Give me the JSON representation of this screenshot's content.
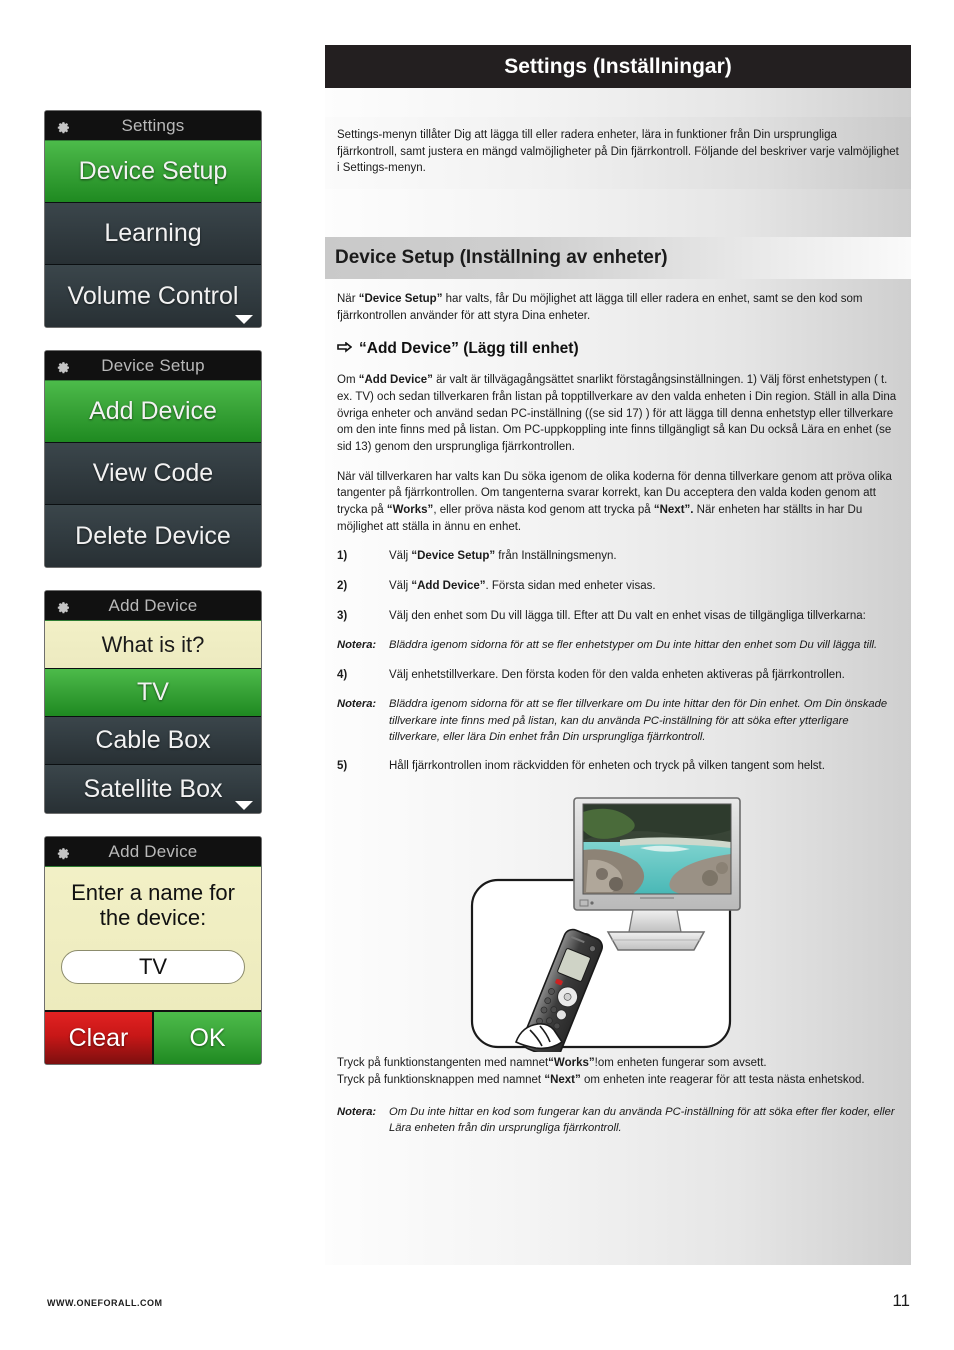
{
  "header": {
    "title": "Settings (Inställningar)"
  },
  "intro": "Settings-menyn tillåter Dig att lägga till eller radera enheter, lära in funktioner från Din ursprungliga fjärrkontroll, samt justera en mängd valmöjligheter på Din fjärrkontroll. Följande del beskriver varje valmöjlighet i Settings-menyn.",
  "section": {
    "title": "Device Setup (Inställning av enheter)"
  },
  "paragraphs": {
    "p1_pre": "När ",
    "p1_b1": "“Device Setup”",
    "p1_post": " har valts, får Du möjlighet att lägga till eller radera en enhet, samt se den kod som fjärrkontrollen använder för att styra Dina enheter.",
    "subheading": "“Add Device” (Lägg till enhet)",
    "p2_pre": "Om ",
    "p2_b1": "“Add Device”",
    "p2_post": " är valt är tillvägagångsättet snarlikt förstagångsinställningen. 1) Välj först enhetstypen ( t. ex. TV) och sedan tillverkaren från listan på topptillverkare av den valda enheten i Din region. Ställ in alla Dina övriga enheter och använd sedan PC-inställning  ((se sid 17) ) för att lägga till denna enhetstyp eller tillverkare om den inte finns med på listan. Om PC-uppkoppling inte finns tillgängligt så kan Du också Lära en enhet (se sid 13) genom den ursprungliga fjärrkontrollen.",
    "p3_pre": "När väl tillverkaren har valts kan Du söka igenom de olika koderna för denna tillverkare genom att pröva olika tangenter på fjärrkontrollen. Om tangenterna svarar korrekt, kan Du acceptera den valda koden genom att trycka på ",
    "p3_b1": "“Works”",
    "p3_mid": ", eller pröva nästa kod genom att trycka på ",
    "p3_b2": "“Next”.",
    "p3_post": " När enheten har ställts in har Du möjlighet att ställa in ännu en enhet."
  },
  "steps": [
    {
      "num": "1)",
      "pre": "Välj ",
      "bold": "“Device Setup”",
      "post": "  från Inställningsmenyn."
    },
    {
      "num": "2)",
      "pre": "Välj ",
      "bold": "“Add Device”",
      "post": ". Första sidan med enheter visas."
    },
    {
      "num": "3)",
      "pre": "Välj den enhet som Du vill lägga till. Efter att Du valt en enhet visas de tillgängliga tillverkarna:",
      "bold": "",
      "post": ""
    },
    {
      "num": "4)",
      "pre": "Välj enhetstillverkare. Den första koden för den valda enheten aktiveras på fjärrkontrollen.",
      "bold": "",
      "post": ""
    },
    {
      "num": "5)",
      "pre": "Håll fjärrkontrollen inom räckvidden för enheten och tryck på vilken tangent som helst.",
      "bold": "",
      "post": ""
    }
  ],
  "notes": {
    "label": "Notera:",
    "note1": "Bläddra igenom sidorna för att se fler enhetstyper om Du inte hittar den enhet som Du vill lägga till.",
    "note2": "Bläddra igenom sidorna för att se fler tillverkare om Du inte hittar den för Din enhet.  Om Din önskade tillverkare inte finns med på listan, kan du använda PC-inställning för att söka efter ytterligare tillverkare, eller lära Din enhet från Din ursprungliga fjärrkontroll.",
    "note3": "Om Du inte hittar en kod som fungerar kan du använda PC-inställning för att söka efter fler koder, eller Lära enheten från din ursprungliga fjärrkontroll."
  },
  "closing": {
    "line1_pre": "Tryck på funktionstangenten med namnet",
    "line1_b": "“Works”",
    "line1_post": "!om enheten fungerar som avsett.",
    "line2_pre": "Tryck på funktionsknappen med namnet ",
    "line2_b": "“Next”",
    "line2_post": " om enheten inte reagerar för att testa nästa enhetskod."
  },
  "screens": [
    {
      "id": "settings",
      "header": "Settings",
      "rows": [
        {
          "label": "Device Setup",
          "state": "green"
        },
        {
          "label": "Learning",
          "state": "dark"
        },
        {
          "label": "Volume Control",
          "state": "dark",
          "caret": true
        }
      ]
    },
    {
      "id": "device-setup",
      "header": "Device Setup",
      "rows": [
        {
          "label": "Add Device",
          "state": "green"
        },
        {
          "label": "View Code",
          "state": "dark"
        },
        {
          "label": "Delete Device",
          "state": "dark"
        }
      ]
    },
    {
      "id": "add-device-list",
      "header": "Add Device",
      "rows": [
        {
          "label": "What is it?",
          "state": "yellow"
        },
        {
          "label": "TV",
          "state": "green"
        },
        {
          "label": "Cable Box",
          "state": "dark"
        },
        {
          "label": "Satellite Box",
          "state": "dark",
          "caret": true
        }
      ]
    }
  ],
  "name_screen": {
    "header": "Add Device",
    "prompt_line1": "Enter a name for",
    "prompt_line2": "the device:",
    "input_value": "TV",
    "clear_label": "Clear",
    "ok_label": "OK"
  },
  "footer": {
    "url": "WWW.ONEFORALL.COM",
    "page": "11"
  },
  "colors": {
    "title_bar": "#231f20",
    "green": "#3ba63a",
    "dark_row": "#323c41",
    "yellow": "#f0eec2",
    "red": "#c81717"
  }
}
